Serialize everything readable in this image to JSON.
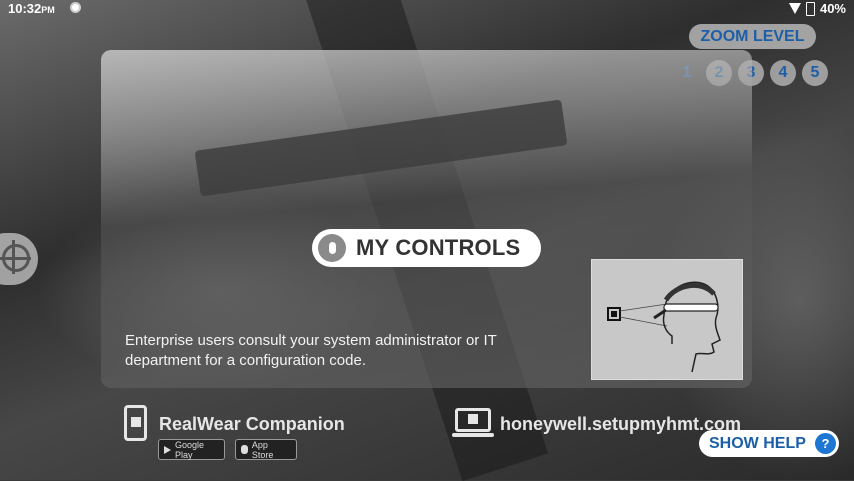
{
  "status_bar": {
    "time": "10:32",
    "ampm": "PM",
    "battery": "40%"
  },
  "zoom": {
    "label": "ZOOM LEVEL",
    "levels": [
      "1",
      "2",
      "3",
      "4",
      "5"
    ],
    "selected": "1"
  },
  "panel": {
    "controls_label": "MY CONTROLS",
    "enterprise_text": "Enterprise users consult your system administrator or IT department for a configuration code."
  },
  "companion": {
    "title": "RealWear Companion",
    "google_play": "Google Play",
    "app_store": "App Store"
  },
  "website": {
    "url": "honeywell.setupmyhmt.com"
  },
  "help": {
    "label": "SHOW HELP",
    "icon_text": "?"
  },
  "colors": {
    "accent": "#1d5ea8",
    "help_badge": "#1d76d2"
  },
  "icons": {
    "mic": "microphone-icon",
    "target": "crosshair-icon",
    "phone": "phone-qr-icon",
    "laptop": "laptop-qr-icon"
  }
}
